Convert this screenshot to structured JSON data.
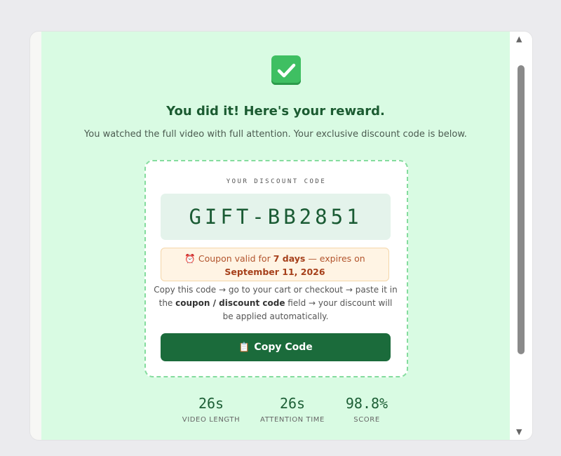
{
  "reward": {
    "headline": "You did it! Here's your reward.",
    "subtext": "You watched the full video with full attention. Your exclusive discount code is below."
  },
  "code_card": {
    "label": "YOUR DISCOUNT CODE",
    "code": "GIFT-BB2851",
    "expiry": {
      "icon": "alarm-clock-icon",
      "prefix": "Coupon valid for",
      "duration": "7 days",
      "middle": "— expires on",
      "date": "September 11, 2026"
    },
    "instructions": {
      "part1": "Copy this code → go to your cart or checkout → paste it in the",
      "bold": "coupon / discount code",
      "part2": "field → your discount will be applied automatically."
    },
    "copy_button": {
      "icon": "clipboard-icon",
      "label": "Copy Code"
    }
  },
  "stats": [
    {
      "value": "26s",
      "label": "VIDEO LENGTH"
    },
    {
      "value": "26s",
      "label": "ATTENTION TIME"
    },
    {
      "value": "98.8%",
      "label": "SCORE"
    }
  ],
  "colors": {
    "page_background": "#d9fbe3",
    "accent_green": "#1b6b3b",
    "headline_green": "#1b5b31",
    "expiry_text": "#b2542d"
  }
}
